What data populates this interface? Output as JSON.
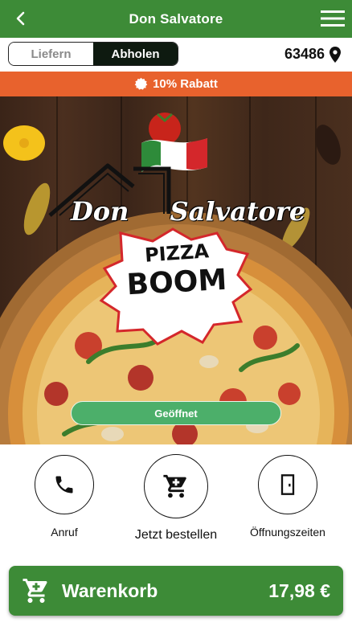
{
  "header": {
    "title": "Don Salvatore",
    "back_icon": "chevron-left-icon",
    "menu_icon": "hamburger-menu-icon"
  },
  "mode_toggle": {
    "options": [
      "Liefern",
      "Abholen"
    ],
    "selected": "Abholen"
  },
  "location": {
    "postcode": "63486",
    "icon": "map-pin-icon"
  },
  "promo": {
    "icon": "badge-icon",
    "text": "10% Rabatt"
  },
  "hero": {
    "logo_line1": "Don",
    "logo_line2": "Salvatore",
    "badge_line1": "PIZZA",
    "badge_line2": "BOOM",
    "status": "Geöffnet"
  },
  "actions": [
    {
      "label": "Anruf",
      "icon": "phone-icon"
    },
    {
      "label": "Jetzt bestellen",
      "icon": "shopping-cart-icon"
    },
    {
      "label": "Öffnungszeiten",
      "icon": "door-icon"
    }
  ],
  "cart": {
    "label": "Warenkorb",
    "total": "17,98 €",
    "icon": "shopping-cart-icon"
  },
  "colors": {
    "brand_green": "#3d8b37",
    "promo_orange": "#e8622d",
    "status_green": "#4caf6a",
    "toggle_dark": "#0e1a10"
  }
}
